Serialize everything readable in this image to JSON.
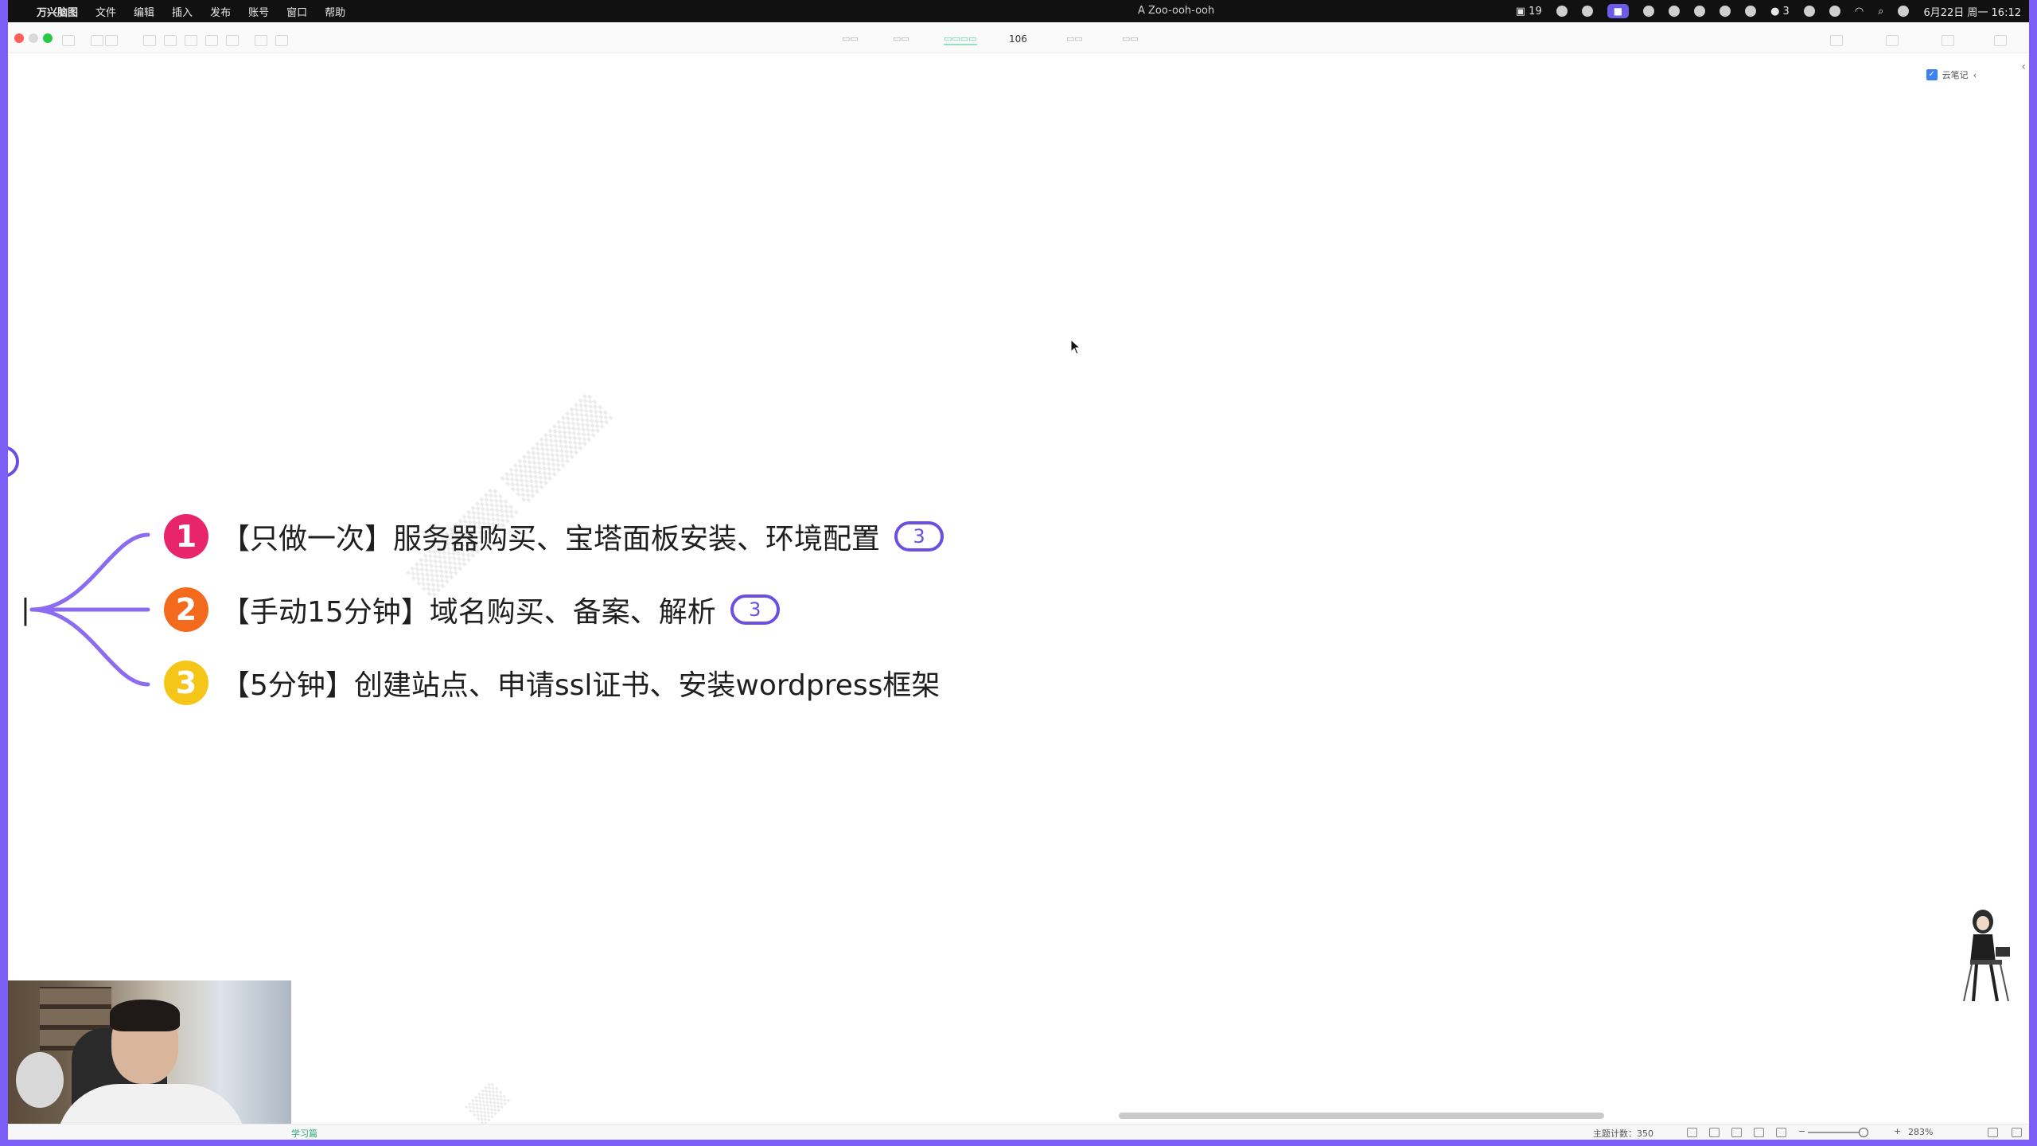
{
  "menubar": {
    "app_name": "万兴脑图",
    "items": [
      "文件",
      "编辑",
      "插入",
      "发布",
      "账号",
      "窗口",
      "帮助"
    ],
    "center_label": "A Zoo-ooh-ooh",
    "badge_count": "19",
    "wechat_count": "3",
    "datetime": "6月22日 周一 16:12"
  },
  "toolbar": {
    "item_count": "106"
  },
  "note_badge": {
    "label": "云笔记"
  },
  "mindmap": {
    "branch_color": "#8b6cf0",
    "items": [
      {
        "number": "1",
        "color": "#e8246b",
        "text": "【只做一次】服务器购买、宝塔面板安装、环境配置",
        "badge": "3"
      },
      {
        "number": "2",
        "color": "#f36a1d",
        "text": "【手动15分钟】域名购买、备案、解析",
        "badge": "3"
      },
      {
        "number": "3",
        "color": "#f5c518",
        "text": "【5分钟】创建站点、申请ssl证书、安装wordpress框架",
        "badge": ""
      }
    ]
  },
  "statusbar": {
    "word_count": "主题计数：350",
    "zoom": "283%",
    "left_label": "学习篇"
  }
}
